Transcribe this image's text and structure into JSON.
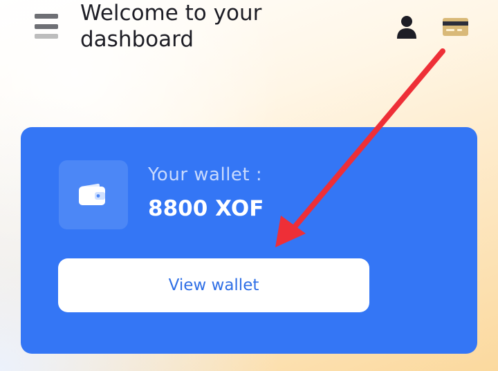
{
  "header": {
    "title": "Welcome to your dashboard",
    "menu_icon": "hamburger-menu-icon",
    "profile_icon": "user-icon",
    "card_icon": "credit-card-icon"
  },
  "wallet": {
    "label": "Your wallet :",
    "balance": "8800 XOF",
    "icon": "wallet-icon",
    "button_label": "View wallet"
  },
  "colors": {
    "card_background": "#3476f5",
    "button_text": "#2f6fe6",
    "annotation_arrow": "#ee2f37"
  },
  "annotation": {
    "type": "arrow",
    "color": "#ee2f37",
    "points_to": "view-wallet-button"
  }
}
